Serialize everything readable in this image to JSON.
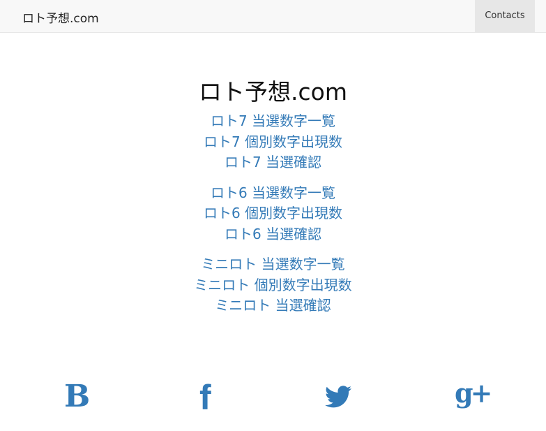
{
  "nav": {
    "brand": "ロト予想.com",
    "contacts": "Contacts"
  },
  "main": {
    "title": "ロト予想.com",
    "groups": [
      {
        "links": [
          "ロト7 当選数字一覧",
          "ロト7 個別数字出現数",
          "ロト7 当選確認"
        ]
      },
      {
        "links": [
          "ロト6 当選数字一覧",
          "ロト6 個別数字出現数",
          "ロト6 当選確認"
        ]
      },
      {
        "links": [
          "ミニロト 当選数字一覧",
          "ミニロト 個別数字出現数",
          "ミニロト 当選確認"
        ]
      }
    ]
  },
  "social": {
    "blog": "B",
    "facebook": "f",
    "googleplus": "g+",
    "color": "#337ab7"
  }
}
